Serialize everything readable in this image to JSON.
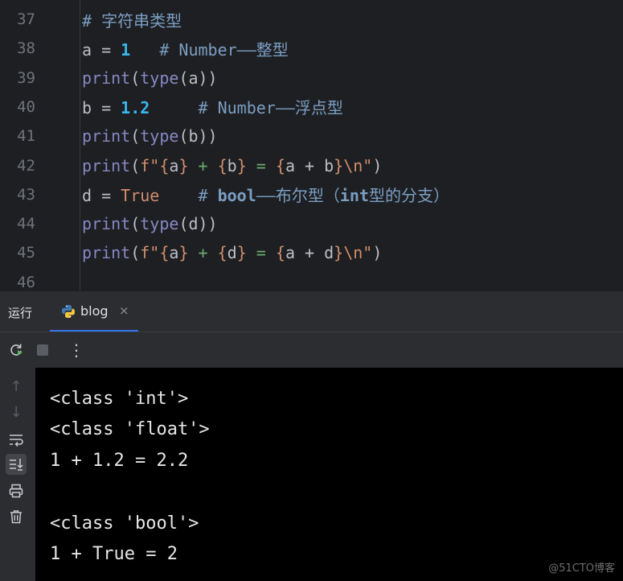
{
  "editor": {
    "lines": [
      {
        "num": "37",
        "tokens": [
          {
            "t": "# ",
            "c": "t-comment"
          },
          {
            "t": "字符串类型",
            "c": "t-comment t-cjk"
          }
        ]
      },
      {
        "num": "38",
        "tokens": [
          {
            "t": "a = ",
            "c": "t-plain"
          },
          {
            "t": "1",
            "c": "t-num"
          },
          {
            "t": "   # Number——",
            "c": "t-comment"
          },
          {
            "t": "整型",
            "c": "t-comment t-cjk"
          }
        ]
      },
      {
        "num": "39",
        "tokens": [
          {
            "t": "print",
            "c": "t-builtin"
          },
          {
            "t": "(",
            "c": "t-plain"
          },
          {
            "t": "type",
            "c": "t-builtin"
          },
          {
            "t": "(a))",
            "c": "t-plain"
          }
        ]
      },
      {
        "num": "40",
        "tokens": [
          {
            "t": "b = ",
            "c": "t-plain"
          },
          {
            "t": "1.2",
            "c": "t-num"
          },
          {
            "t": "     # Number——",
            "c": "t-comment"
          },
          {
            "t": "浮点型",
            "c": "t-comment t-cjk"
          }
        ]
      },
      {
        "num": "41",
        "tokens": [
          {
            "t": "print",
            "c": "t-builtin"
          },
          {
            "t": "(",
            "c": "t-plain"
          },
          {
            "t": "type",
            "c": "t-builtin"
          },
          {
            "t": "(b))",
            "c": "t-plain"
          }
        ]
      },
      {
        "num": "42",
        "tokens": [
          {
            "t": "print",
            "c": "t-builtin"
          },
          {
            "t": "(",
            "c": "t-plain"
          },
          {
            "t": "f\"",
            "c": "t-fstr"
          },
          {
            "t": "{",
            "c": "t-brace"
          },
          {
            "t": "a",
            "c": "t-plain"
          },
          {
            "t": "}",
            "c": "t-brace"
          },
          {
            "t": " + ",
            "c": "t-str"
          },
          {
            "t": "{",
            "c": "t-brace"
          },
          {
            "t": "b",
            "c": "t-plain"
          },
          {
            "t": "}",
            "c": "t-brace"
          },
          {
            "t": " = ",
            "c": "t-str"
          },
          {
            "t": "{",
            "c": "t-brace"
          },
          {
            "t": "a + b",
            "c": "t-plain"
          },
          {
            "t": "}",
            "c": "t-brace"
          },
          {
            "t": "\\n",
            "c": "t-esc"
          },
          {
            "t": "\"",
            "c": "t-fstr"
          },
          {
            "t": ")",
            "c": "t-plain"
          }
        ]
      },
      {
        "num": "43",
        "tokens": [
          {
            "t": "d = ",
            "c": "t-plain"
          },
          {
            "t": "True",
            "c": "t-kw"
          },
          {
            "t": "    # ",
            "c": "t-comment"
          },
          {
            "t": "bool",
            "c": "t-comment-kw"
          },
          {
            "t": "——",
            "c": "t-comment"
          },
          {
            "t": "布尔型（",
            "c": "t-comment t-cjk"
          },
          {
            "t": "int",
            "c": "t-comment-kw"
          },
          {
            "t": "型的分支）",
            "c": "t-comment t-cjk"
          }
        ]
      },
      {
        "num": "44",
        "tokens": [
          {
            "t": "print",
            "c": "t-builtin"
          },
          {
            "t": "(",
            "c": "t-plain"
          },
          {
            "t": "type",
            "c": "t-builtin"
          },
          {
            "t": "(d))",
            "c": "t-plain"
          }
        ]
      },
      {
        "num": "45",
        "tokens": [
          {
            "t": "print",
            "c": "t-builtin"
          },
          {
            "t": "(",
            "c": "t-plain"
          },
          {
            "t": "f\"",
            "c": "t-fstr"
          },
          {
            "t": "{",
            "c": "t-brace"
          },
          {
            "t": "a",
            "c": "t-plain"
          },
          {
            "t": "}",
            "c": "t-brace"
          },
          {
            "t": " + ",
            "c": "t-str"
          },
          {
            "t": "{",
            "c": "t-brace"
          },
          {
            "t": "d",
            "c": "t-plain"
          },
          {
            "t": "}",
            "c": "t-brace"
          },
          {
            "t": " = ",
            "c": "t-str"
          },
          {
            "t": "{",
            "c": "t-brace"
          },
          {
            "t": "a + d",
            "c": "t-plain"
          },
          {
            "t": "}",
            "c": "t-brace"
          },
          {
            "t": "\\n",
            "c": "t-esc"
          },
          {
            "t": "\"",
            "c": "t-fstr"
          },
          {
            "t": ")",
            "c": "t-plain"
          }
        ]
      },
      {
        "num": "46",
        "tokens": []
      }
    ]
  },
  "run_panel": {
    "label": "运行",
    "tab": {
      "label": "blog",
      "icon": "python-icon",
      "close": "×"
    }
  },
  "toolbar": {
    "buttons": [
      {
        "name": "rerun-button",
        "icon": "rerun-icon"
      },
      {
        "name": "stop-button",
        "icon": "stop-icon"
      },
      {
        "name": "more-options-button",
        "icon": "kebab-icon",
        "glyph": "⋮"
      }
    ]
  },
  "rail": {
    "buttons": [
      {
        "name": "scroll-up-button",
        "icon": "arrow-up-icon",
        "glyph": "↑"
      },
      {
        "name": "scroll-down-button",
        "icon": "arrow-down-icon",
        "glyph": "↓"
      },
      {
        "name": "soft-wrap-button",
        "icon": "soft-wrap-icon"
      },
      {
        "name": "scroll-to-end-button",
        "icon": "scroll-to-end-icon"
      },
      {
        "name": "print-button",
        "icon": "print-icon"
      },
      {
        "name": "clear-all-button",
        "icon": "trash-icon"
      }
    ]
  },
  "console": {
    "lines": [
      "<class 'int'>",
      "<class 'float'>",
      "1 + 1.2 = 2.2",
      "",
      "<class 'bool'>",
      "1 + True = 2"
    ],
    "watermark": "@51CTO博客"
  },
  "colors": {
    "editor_bg": "#1e1f22",
    "panel_bg": "#2b2d30",
    "console_bg": "#000000",
    "accent": "#3574f0"
  }
}
